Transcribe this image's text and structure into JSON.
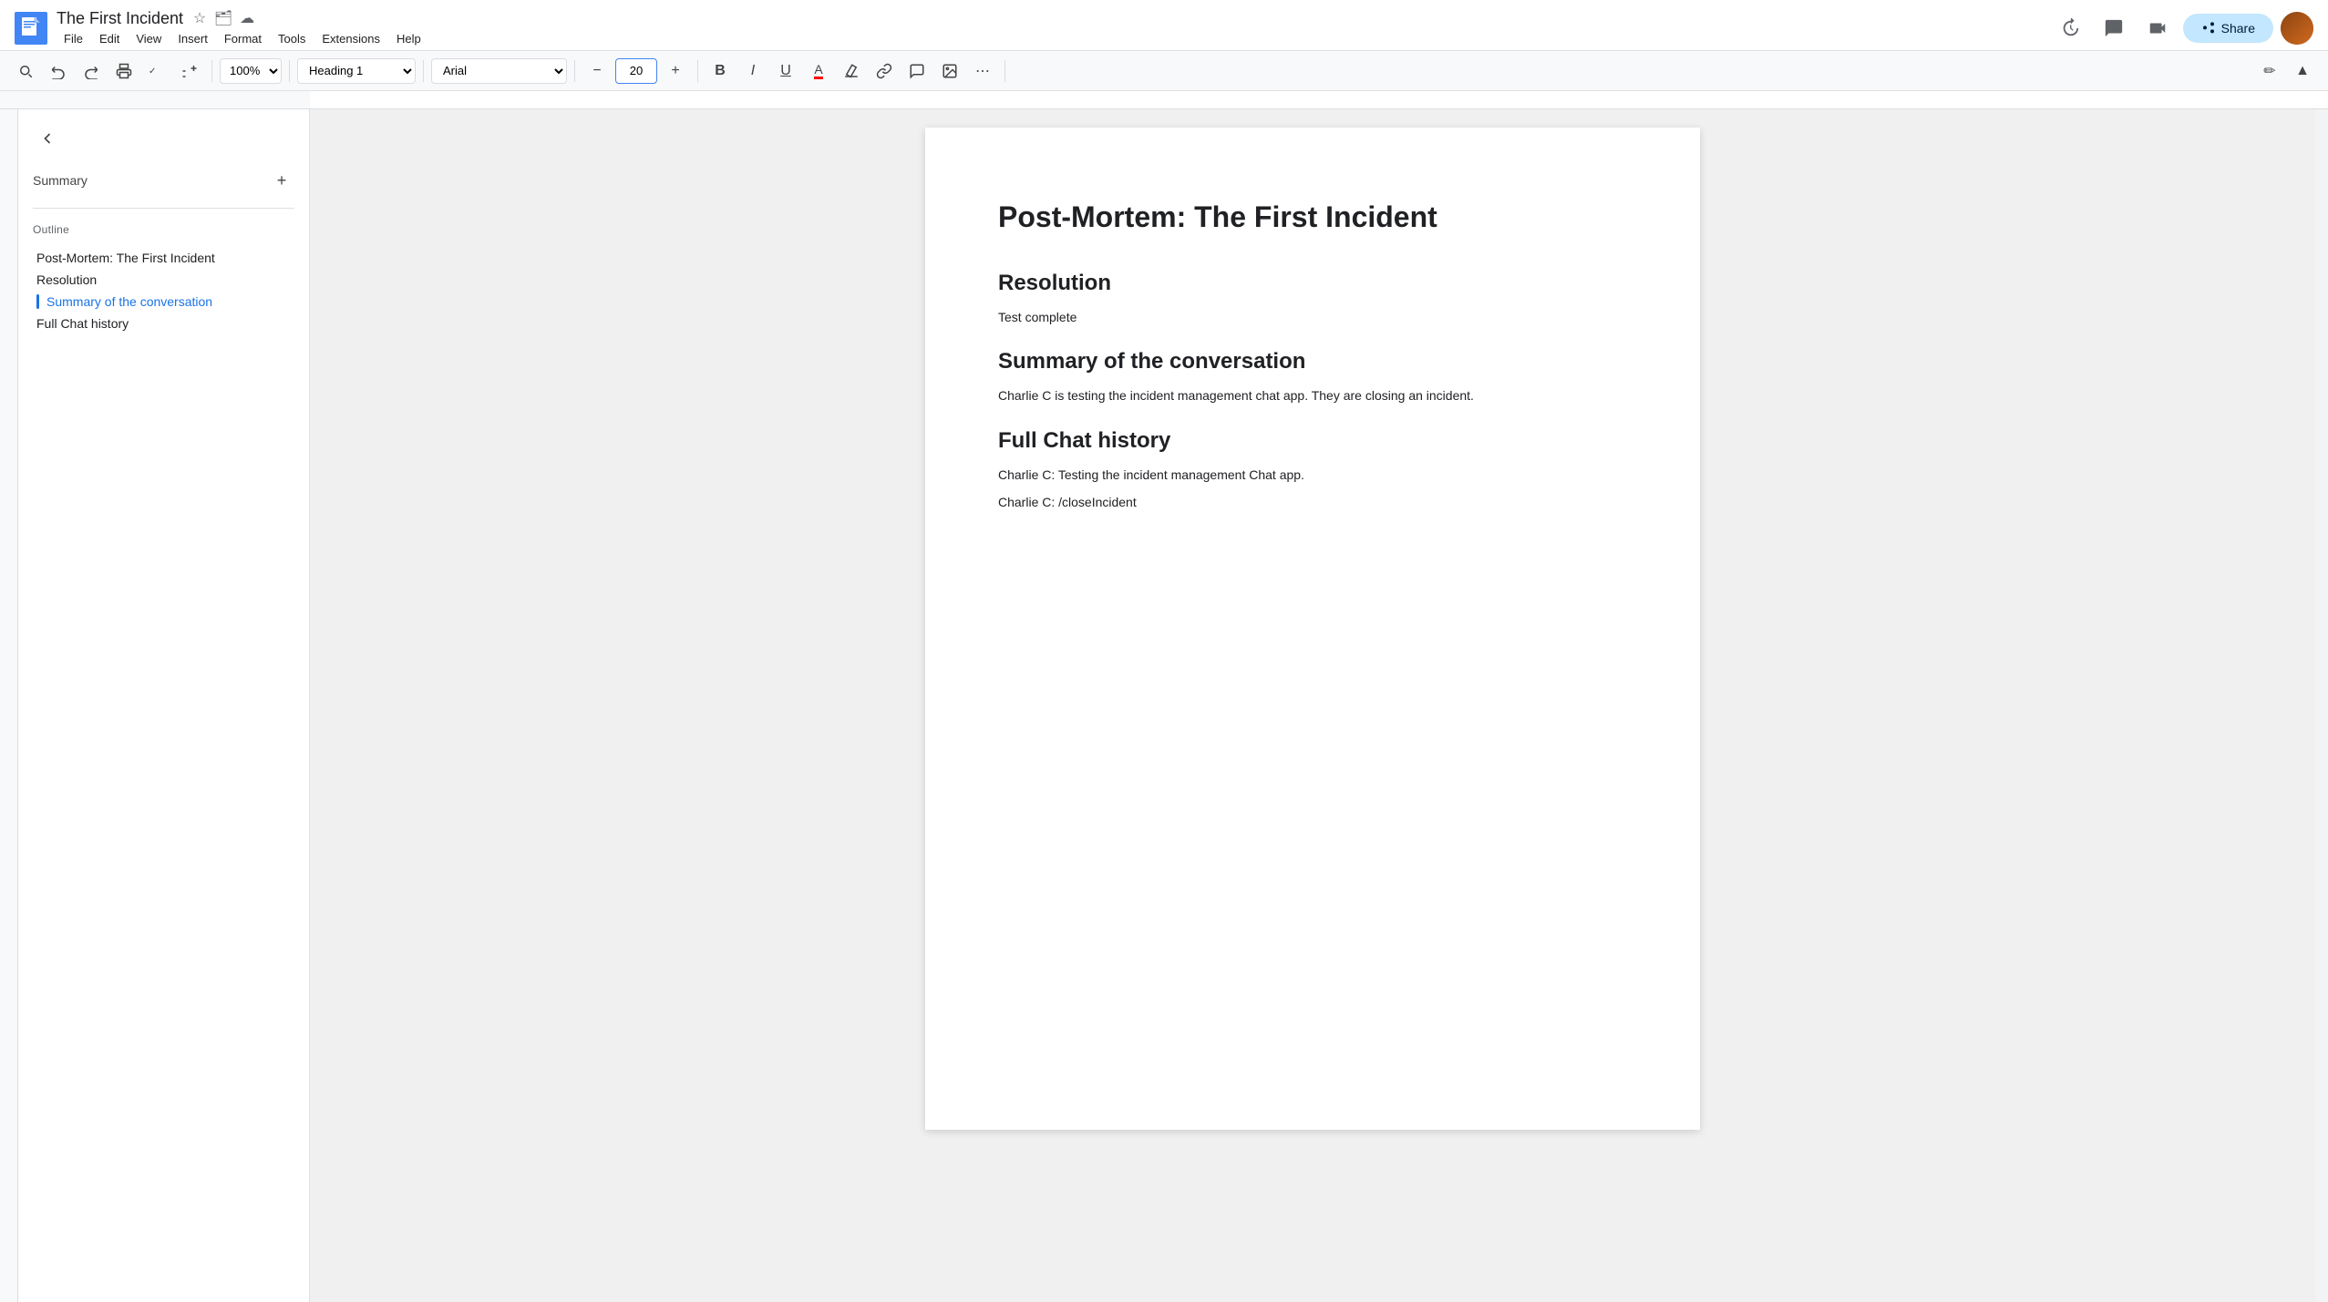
{
  "titleBar": {
    "docTitle": "The First Incident",
    "menuItems": [
      "File",
      "Edit",
      "View",
      "Insert",
      "Format",
      "Tools",
      "Extensions",
      "Help"
    ]
  },
  "toolbar": {
    "zoom": "100%",
    "style": "Heading 1",
    "font": "Arial",
    "fontSize": "20",
    "boldLabel": "B",
    "italicLabel": "I",
    "underlineLabel": "U"
  },
  "sidebar": {
    "summaryLabel": "Summary",
    "outlineLabel": "Outline",
    "outlineItems": [
      {
        "label": "Post-Mortem: The First Incident",
        "active": false
      },
      {
        "label": "Resolution",
        "active": false
      },
      {
        "label": "Summary of the conversation",
        "active": true
      },
      {
        "label": "Full Chat history",
        "active": false
      }
    ]
  },
  "document": {
    "mainTitle": "Post-Mortem: The First Incident",
    "sections": [
      {
        "heading": "Resolution",
        "paragraphs": [
          "Test complete"
        ]
      },
      {
        "heading": "Summary of the conversation",
        "paragraphs": [
          "Charlie C is testing the incident management chat app. They are closing an incident."
        ]
      },
      {
        "heading": "Full Chat history",
        "paragraphs": [
          "Charlie C: Testing the incident management Chat app.",
          "Charlie C: /closeIncident"
        ]
      }
    ]
  },
  "share": {
    "label": "Share"
  }
}
